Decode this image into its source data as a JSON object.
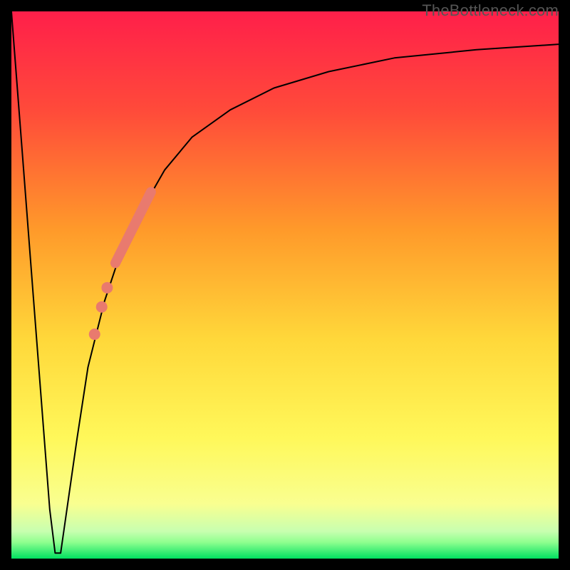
{
  "watermark": "TheBottleneck.com",
  "chart_data": {
    "type": "line",
    "title": "",
    "xlabel": "",
    "ylabel": "",
    "xlim": [
      0,
      100
    ],
    "ylim": [
      0,
      100
    ],
    "grid": false,
    "background": "vertical-gradient",
    "background_colors": {
      "top": "#ff1f4a",
      "upper": "#ff7a2a",
      "mid": "#ffe83a",
      "lower": "#f9ff70",
      "bottom_band_top": "#8fff8f",
      "bottom_band_bottom": "#00e060"
    },
    "series": [
      {
        "name": "bottleneck-curve",
        "x": [
          0,
          2,
          4,
          6,
          7,
          8,
          9,
          10,
          12,
          14,
          17,
          20,
          24,
          28,
          33,
          40,
          48,
          58,
          70,
          85,
          100
        ],
        "y": [
          100,
          74,
          48,
          22,
          9,
          1,
          1,
          8,
          22,
          35,
          47,
          56,
          64,
          71,
          77,
          82,
          86,
          89,
          91.5,
          93,
          94
        ],
        "stroke": "#000000",
        "stroke_width": 2
      }
    ],
    "markers": [
      {
        "name": "highlight-segment",
        "type": "thick-line",
        "x": [
          19,
          25.5
        ],
        "y": [
          54,
          67
        ],
        "color": "#e97a6e",
        "width": 14
      },
      {
        "name": "highlight-dots",
        "type": "dots",
        "points": [
          {
            "x": 17.5,
            "y": 49.5
          },
          {
            "x": 16.5,
            "y": 46
          },
          {
            "x": 15.2,
            "y": 41
          }
        ],
        "color": "#e97a6e",
        "radius": 8
      }
    ]
  }
}
